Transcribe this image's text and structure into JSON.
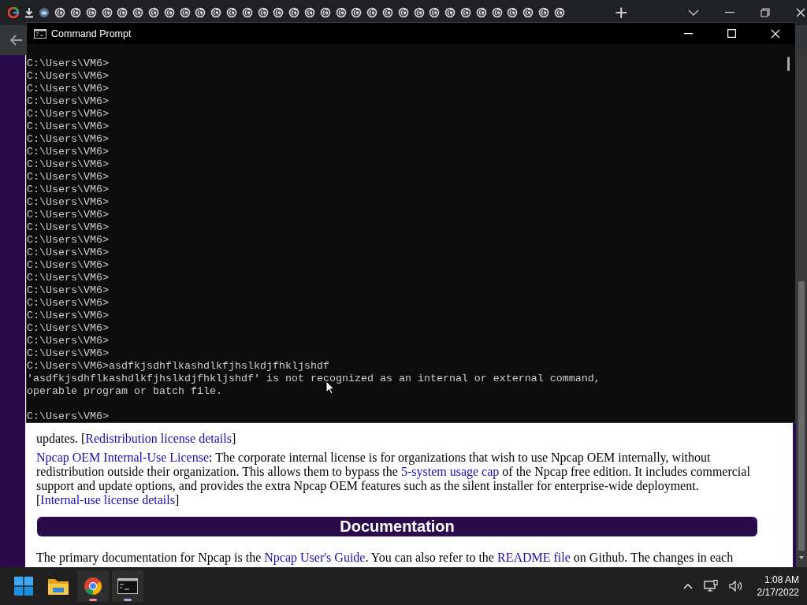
{
  "browser": {
    "tabs": [
      {
        "kind": "google"
      },
      {
        "kind": "download"
      },
      {
        "kind": "app"
      },
      {
        "kind": "page"
      },
      {
        "kind": "page"
      },
      {
        "kind": "page"
      },
      {
        "kind": "page"
      },
      {
        "kind": "page"
      },
      {
        "kind": "page"
      },
      {
        "kind": "page"
      },
      {
        "kind": "page"
      },
      {
        "kind": "page"
      },
      {
        "kind": "page"
      },
      {
        "kind": "page"
      },
      {
        "kind": "page"
      },
      {
        "kind": "page"
      },
      {
        "kind": "page"
      },
      {
        "kind": "page"
      },
      {
        "kind": "page"
      },
      {
        "kind": "page"
      },
      {
        "kind": "page"
      },
      {
        "kind": "page"
      },
      {
        "kind": "page"
      },
      {
        "kind": "page"
      },
      {
        "kind": "page"
      },
      {
        "kind": "page"
      },
      {
        "kind": "page"
      },
      {
        "kind": "page"
      },
      {
        "kind": "page"
      },
      {
        "kind": "page"
      },
      {
        "kind": "page"
      },
      {
        "kind": "page"
      },
      {
        "kind": "page"
      },
      {
        "kind": "page"
      },
      {
        "kind": "page"
      },
      {
        "kind": "page"
      }
    ],
    "new_tab": "+",
    "page": {
      "blocks": [
        {
          "kind": "paragraph",
          "segments": [
            {
              "text": "updates. [",
              "link": false
            },
            {
              "text": "Redistribution license details",
              "link": true
            },
            {
              "text": "]",
              "link": false
            }
          ]
        },
        {
          "kind": "paragraph",
          "segments": [
            {
              "text": "Npcap OEM Internal-Use License",
              "link": true
            },
            {
              "text": ": The corporate internal license is for organizations that wish to use Npcap OEM internally, without redistribution outside their organization. This allows them to bypass the ",
              "link": false
            },
            {
              "text": "5-system usage cap",
              "link": true
            },
            {
              "text": " of the Npcap free edition. It includes commercial support and update options, and provides the extra Npcap OEM features such as the silent installer for enterprise-wide deployment. [",
              "link": false
            },
            {
              "text": "Internal-use license details",
              "link": true
            },
            {
              "text": "]",
              "link": false
            }
          ]
        },
        {
          "kind": "heading",
          "text": "Documentation"
        },
        {
          "kind": "paragraph",
          "segments": [
            {
              "text": "The primary documentation for Npcap is the ",
              "link": false
            },
            {
              "text": "Npcap User's Guide",
              "link": true
            },
            {
              "text": ". You can also refer to the ",
              "link": false
            },
            {
              "text": "README file",
              "link": true
            },
            {
              "text": " on Github. The changes in each",
              "link": false
            }
          ]
        }
      ]
    }
  },
  "console": {
    "title": "Command Prompt",
    "lines": [
      {
        "kind": "text",
        "text": "C:\\Users\\VM6>"
      },
      {
        "kind": "text",
        "text": "C:\\Users\\VM6>"
      },
      {
        "kind": "text",
        "text": "C:\\Users\\VM6>"
      },
      {
        "kind": "text",
        "text": "C:\\Users\\VM6>"
      },
      {
        "kind": "text",
        "text": "C:\\Users\\VM6>"
      },
      {
        "kind": "text",
        "text": "C:\\Users\\VM6>"
      },
      {
        "kind": "text",
        "text": "C:\\Users\\VM6>"
      },
      {
        "kind": "text",
        "text": "C:\\Users\\VM6>"
      },
      {
        "kind": "text",
        "text": "C:\\Users\\VM6>"
      },
      {
        "kind": "text",
        "text": "C:\\Users\\VM6>"
      },
      {
        "kind": "text",
        "text": "C:\\Users\\VM6>"
      },
      {
        "kind": "text",
        "text": "C:\\Users\\VM6>"
      },
      {
        "kind": "text",
        "text": "C:\\Users\\VM6>"
      },
      {
        "kind": "text",
        "text": "C:\\Users\\VM6>"
      },
      {
        "kind": "text",
        "text": "C:\\Users\\VM6>"
      },
      {
        "kind": "text",
        "text": "C:\\Users\\VM6>"
      },
      {
        "kind": "text",
        "text": "C:\\Users\\VM6>"
      },
      {
        "kind": "text",
        "text": "C:\\Users\\VM6>"
      },
      {
        "kind": "text",
        "text": "C:\\Users\\VM6>"
      },
      {
        "kind": "text",
        "text": "C:\\Users\\VM6>"
      },
      {
        "kind": "text",
        "text": "C:\\Users\\VM6>"
      },
      {
        "kind": "text",
        "text": "C:\\Users\\VM6>"
      },
      {
        "kind": "text",
        "text": "C:\\Users\\VM6>"
      },
      {
        "kind": "text",
        "text": "C:\\Users\\VM6>"
      },
      {
        "kind": "text",
        "text": "C:\\Users\\VM6>asdfkjsdhflkashdlkfjhslkdjfhkljshdf"
      },
      {
        "kind": "text",
        "text": "'asdfkjsdhflkashdlkfjhslkdjfhkljshdf' is not recognized as an internal or external command,"
      },
      {
        "kind": "text",
        "text": "operable program or batch file."
      },
      {
        "kind": "blank"
      },
      {
        "kind": "text",
        "text": "C:\\Users\\VM6>"
      }
    ]
  },
  "taskbar": {
    "apps": [
      {
        "kind": "start",
        "running": false
      },
      {
        "kind": "folder",
        "running": false
      },
      {
        "kind": "browser",
        "running": true
      },
      {
        "kind": "terminal",
        "running": true
      }
    ],
    "clock": {
      "time": "1:08 AM",
      "date": "2/17/2022"
    }
  }
}
